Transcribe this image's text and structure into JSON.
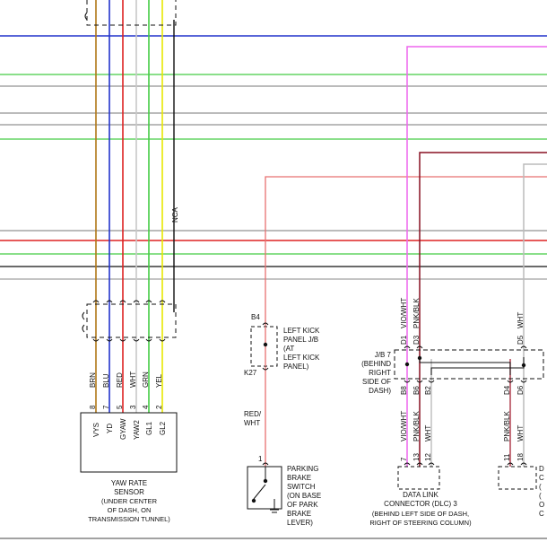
{
  "colors": {
    "brown": "#b07818",
    "blue": "#2233cc",
    "red": "#dd2222",
    "white_wire": "#c8c8c8",
    "green": "#44cc44",
    "yellow": "#e8e800",
    "black": "#111111",
    "pink": "#ee66ee",
    "dark_red": "#881122",
    "violet": "#cc33cc",
    "gray": "#888888"
  },
  "yaw_sensor": {
    "label_lines": [
      "YAW RATE",
      "SENSOR",
      "(UNDER CENTER",
      "OF DASH, ON",
      "TRANSMISSION TUNNEL)"
    ],
    "pins": [
      {
        "pin": "8",
        "wire": "BRN",
        "name": "VYS"
      },
      {
        "pin": "7",
        "wire": "BLU",
        "name": "YD"
      },
      {
        "pin": "5",
        "wire": "RED",
        "name": "GYAW"
      },
      {
        "pin": "3",
        "wire": "WHT",
        "name": "YAW2"
      },
      {
        "pin": "4",
        "wire": "GRN",
        "name": "GL1"
      },
      {
        "pin": "2",
        "wire": "YEL",
        "name": "GL2"
      }
    ],
    "nca": "NCA"
  },
  "kick_panel": {
    "top_pin": "B4",
    "bottom_pin": "K27",
    "label_lines": [
      "LEFT KICK",
      "PANEL J/B",
      "(AT",
      "LEFT KICK",
      "PANEL)"
    ],
    "wire": "RED/\nWHT",
    "wire_lines": [
      "RED/",
      "WHT"
    ]
  },
  "brake_switch": {
    "pin": "1",
    "label_lines": [
      "PARKING",
      "BRAKE",
      "SWITCH",
      "(ON BASE",
      "OF PARK",
      "BRAKE",
      "LEVER)"
    ]
  },
  "jb7": {
    "label_lines": [
      "J/B 7",
      "(BEHIND",
      "RIGHT",
      "SIDE OF",
      "DASH)"
    ],
    "top_wires": [
      {
        "pin": "D1",
        "wire": "VIO/WHT"
      },
      {
        "pin": "D3",
        "wire": "PNK/BLK"
      },
      {
        "pin": "D5",
        "wire": "WHT"
      }
    ],
    "bottom_pins": [
      "B8",
      "B6",
      "B2",
      "D4",
      "D6"
    ]
  },
  "dlc": {
    "wires": [
      {
        "pin": "7",
        "wire": "VIO/WHT"
      },
      {
        "pin": "13",
        "wire": "PNK/BLK"
      },
      {
        "pin": "12",
        "wire": "WHT"
      }
    ],
    "label_lines": [
      "DATA LINK",
      "CONNECTOR (DLC) 3",
      "(BEHIND LEFT SIDE OF DASH,",
      "RIGHT OF STEERING COLUMN)"
    ]
  },
  "right_connector": {
    "wires": [
      {
        "pin": "11",
        "wire": "PNK/BLK"
      },
      {
        "pin": "18",
        "wire": "WHT"
      }
    ],
    "label_fragments": [
      "D",
      "C",
      "(",
      "(",
      "O",
      "C"
    ]
  }
}
